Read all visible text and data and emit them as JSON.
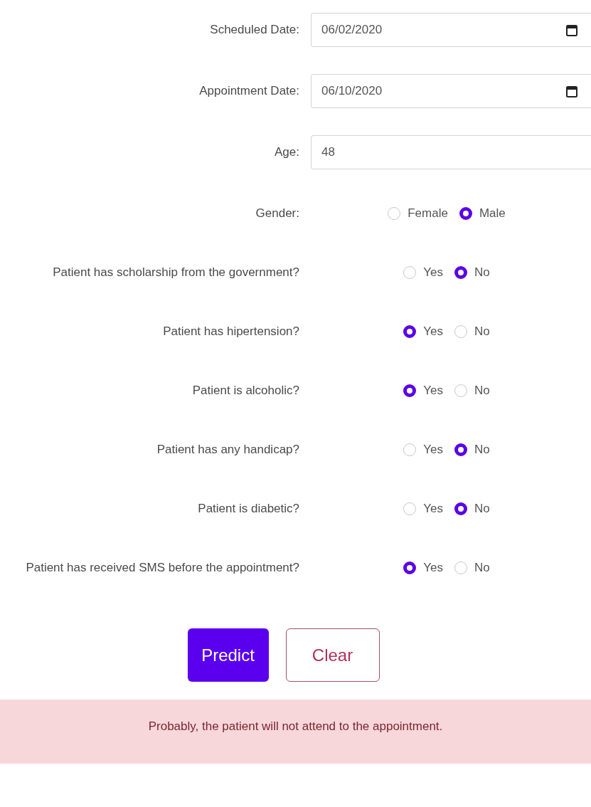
{
  "fields": [
    {
      "label": "Scheduled Date:",
      "value": "06/02/2020",
      "kind": "date"
    },
    {
      "label": "Appointment Date:",
      "value": "06/10/2020",
      "kind": "date"
    },
    {
      "label": "Age:",
      "value": "48",
      "kind": "number"
    }
  ],
  "questions": [
    {
      "label": "Gender:",
      "options": [
        {
          "label": "Female",
          "selected": false
        },
        {
          "label": "Male",
          "selected": true
        }
      ]
    },
    {
      "label": "Patient has scholarship from the government?",
      "options": [
        {
          "label": "Yes",
          "selected": false
        },
        {
          "label": "No",
          "selected": true
        }
      ]
    },
    {
      "label": "Patient has hipertension?",
      "options": [
        {
          "label": "Yes",
          "selected": true
        },
        {
          "label": "No",
          "selected": false
        }
      ]
    },
    {
      "label": "Patient is alcoholic?",
      "options": [
        {
          "label": "Yes",
          "selected": true
        },
        {
          "label": "No",
          "selected": false
        }
      ]
    },
    {
      "label": "Patient has any handicap?",
      "options": [
        {
          "label": "Yes",
          "selected": false
        },
        {
          "label": "No",
          "selected": true
        }
      ]
    },
    {
      "label": "Patient is diabetic?",
      "options": [
        {
          "label": "Yes",
          "selected": false
        },
        {
          "label": "No",
          "selected": true
        }
      ]
    },
    {
      "label": "Patient has received SMS before the appointment?",
      "options": [
        {
          "label": "Yes",
          "selected": true
        },
        {
          "label": "No",
          "selected": false
        }
      ]
    }
  ],
  "buttons": [
    {
      "label": "Predict",
      "kind": "primary"
    },
    {
      "label": "Clear",
      "kind": "outline"
    }
  ],
  "alert": {
    "text": "Probably, the patient will not attend to the appointment."
  }
}
